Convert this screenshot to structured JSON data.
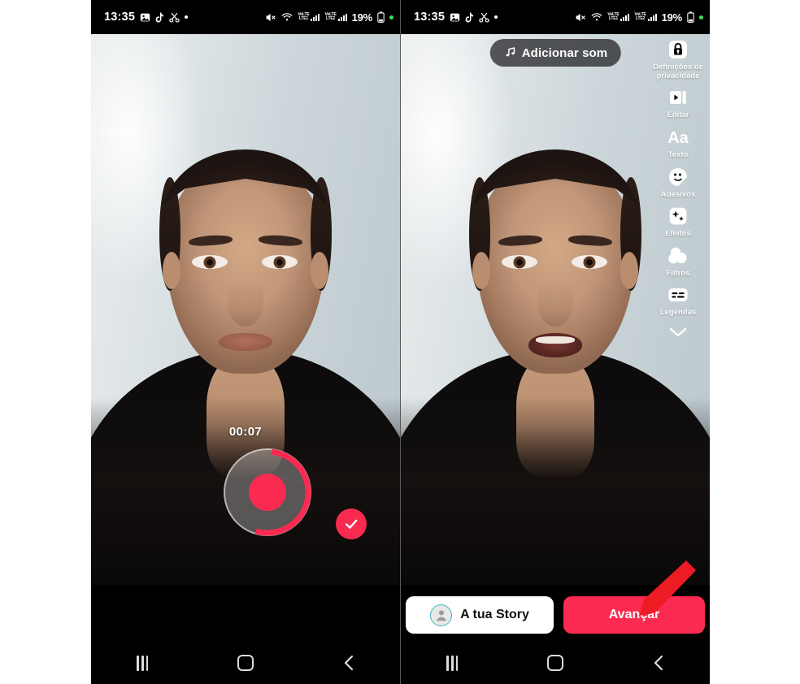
{
  "meta": {
    "app": "TikTok",
    "language": "pt-PT",
    "screens": [
      "recording",
      "post-editing"
    ]
  },
  "statusbar": {
    "time": "13:35",
    "battery": "19%",
    "icons_left": [
      "gallery-icon",
      "tiktok-note-icon",
      "scissors-icon",
      "dot-icon"
    ],
    "icons_right": [
      "mute-icon",
      "wifi-icon",
      "volte-signal-lte1",
      "volte-signal-lte2",
      "battery-icon",
      "green-dot"
    ],
    "signal_1_top": "VoLTE",
    "signal_1_bottom": "LTE1",
    "signal_2_top": "VoLTE",
    "signal_2_bottom": "LTE2"
  },
  "left_panel": {
    "name": "recording-screen",
    "timer": "00:07",
    "record_button_label": "record-button",
    "progress_percent": 52,
    "confirm_label": "confirm-recording",
    "accent": "#FA2A51"
  },
  "right_panel": {
    "name": "post-editing-screen",
    "back_label": "back",
    "sound_button": "Adicionar som",
    "tools": [
      {
        "label": "Definições de privacidade",
        "icon": "lock-icon"
      },
      {
        "label": "Editar",
        "icon": "edit-video-icon"
      },
      {
        "label": "Texto",
        "icon": "text-aa-icon"
      },
      {
        "label": "Adesivos",
        "icon": "sticker-icon"
      },
      {
        "label": "Efeitos",
        "icon": "effects-sparkle-icon"
      },
      {
        "label": "Filtros",
        "icon": "filters-circles-icon"
      },
      {
        "label": "Legendas",
        "icon": "captions-icon"
      }
    ],
    "expand_icon": "chevron-down-icon",
    "story_button": "A tua Story",
    "next_button": "Avançar",
    "next_button_color": "#FA2A51",
    "annotation": "red-arrow-pointing-to-avancar"
  },
  "navbar": {
    "recents": "recents-button",
    "home": "home-button",
    "back": "back-button"
  }
}
